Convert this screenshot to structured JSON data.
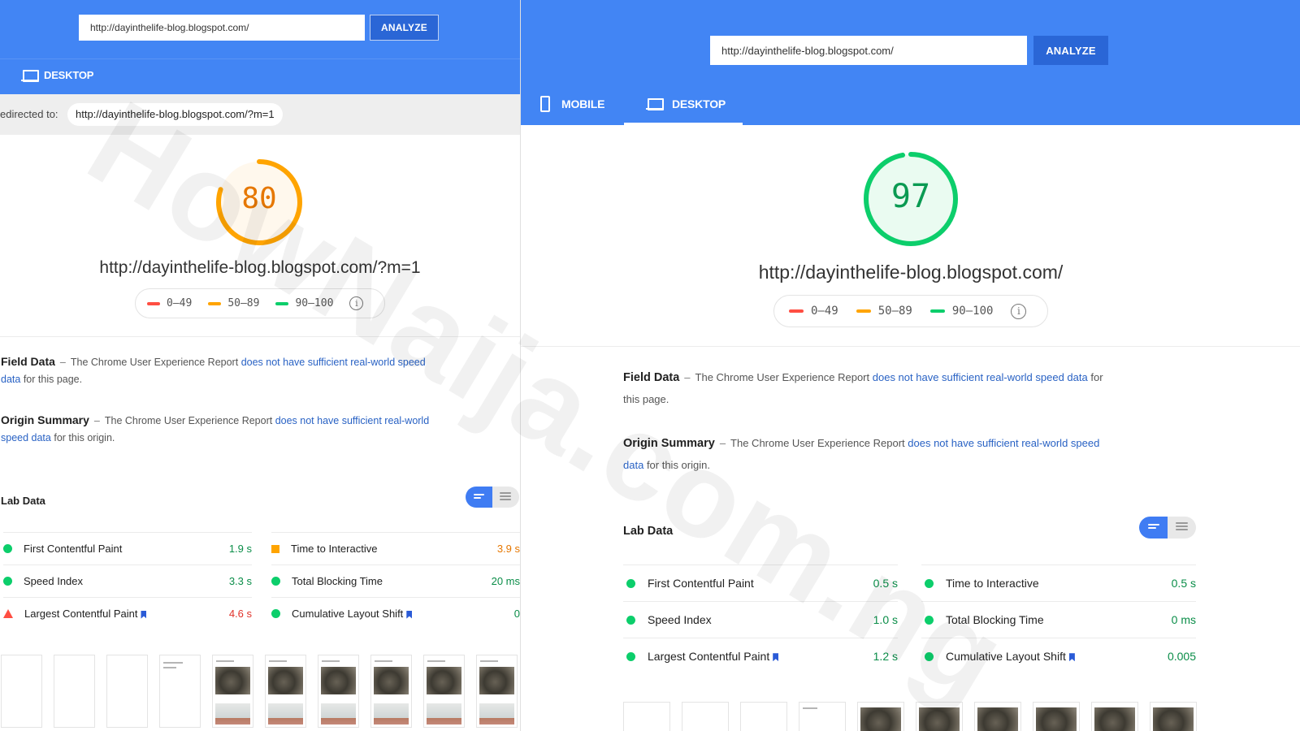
{
  "left": {
    "url_input": "http://dayinthelife-blog.blogspot.com/",
    "analyze_label": "ANALYZE",
    "tab_desktop": "DESKTOP",
    "redirect_label": "edirected to:",
    "redirect_url": "http://dayinthelife-blog.blogspot.com/?m=1",
    "score": "80",
    "score_fraction": 0.8,
    "page_url": "http://dayinthelife-blog.blogspot.com/?m=1",
    "legend": [
      "0–49",
      "50–89",
      "90–100"
    ],
    "field_title": "Field Data",
    "field_pre": "The Chrome User Experience Report",
    "field_link_1": "does not have sufficient real-world speed",
    "field_link_2": "data",
    "field_post": "for this page.",
    "origin_title": "Origin Summary",
    "origin_pre": "The Chrome User Experience Report",
    "origin_link_1": "does not have sufficient real-world",
    "origin_link_2": "speed data",
    "origin_post": "for this origin.",
    "lab_title": "Lab Data",
    "metrics": [
      {
        "label": "First Contentful Paint",
        "value": "1.9 s",
        "status": "good"
      },
      {
        "label": "Time to Interactive",
        "value": "3.9 s",
        "status": "average"
      },
      {
        "label": "Speed Index",
        "value": "3.3 s",
        "status": "good"
      },
      {
        "label": "Total Blocking Time",
        "value": "20 ms",
        "status": "good"
      },
      {
        "label": "Largest Contentful Paint",
        "value": "4.6 s",
        "status": "poor"
      },
      {
        "label": "Cumulative Layout Shift",
        "value": "0",
        "status": "good"
      }
    ]
  },
  "right": {
    "url_input": "http://dayinthelife-blog.blogspot.com/",
    "analyze_label": "ANALYZE",
    "tab_mobile": "MOBILE",
    "tab_desktop": "DESKTOP",
    "score": "97",
    "score_fraction": 0.97,
    "page_url": "http://dayinthelife-blog.blogspot.com/",
    "legend": [
      "0–49",
      "50–89",
      "90–100"
    ],
    "field_title": "Field Data",
    "field_pre": "The Chrome User Experience Report",
    "field_link_1": "does not have sufficient real-world speed data",
    "field_post_1": "for",
    "field_post_2": "this page.",
    "origin_title": "Origin Summary",
    "origin_pre": "The Chrome User Experience Report",
    "origin_link_1": "does not have sufficient real-world speed",
    "origin_link_2": "data",
    "origin_post": "for this origin.",
    "lab_title": "Lab Data",
    "metrics": [
      {
        "label": "First Contentful Paint",
        "value": "0.5 s",
        "status": "good"
      },
      {
        "label": "Time to Interactive",
        "value": "0.5 s",
        "status": "good"
      },
      {
        "label": "Speed Index",
        "value": "1.0 s",
        "status": "good"
      },
      {
        "label": "Total Blocking Time",
        "value": "0 ms",
        "status": "good"
      },
      {
        "label": "Largest Contentful Paint",
        "value": "1.2 s",
        "status": "good"
      },
      {
        "label": "Cumulative Layout Shift",
        "value": "0.005",
        "status": "good"
      }
    ]
  },
  "colors": {
    "brand_blue": "#4285f4",
    "good": "#0cce6b",
    "average": "#ffa400",
    "poor": "#ff4e42",
    "link": "#2962c4"
  },
  "watermark": "HowNaija.com.ng"
}
